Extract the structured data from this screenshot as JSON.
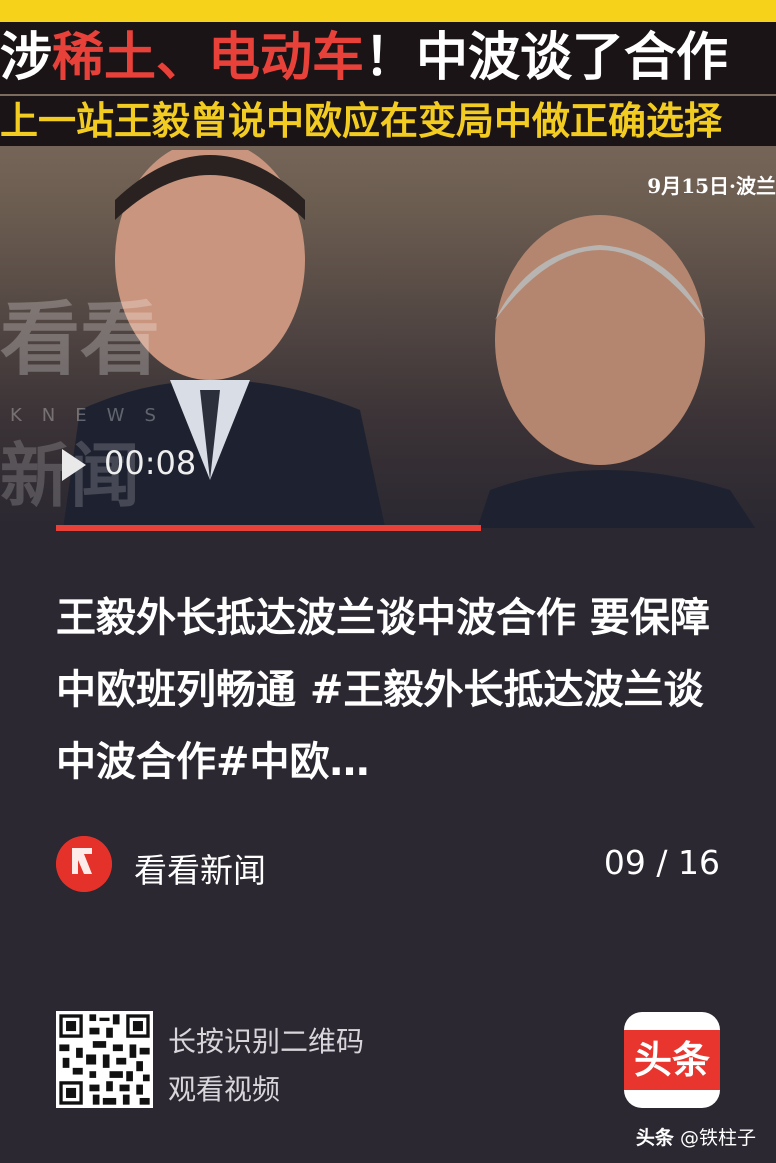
{
  "video": {
    "headline_part1": "涉",
    "headline_red1": "稀土、电动车",
    "headline_part2": "！中波谈了合作",
    "subline": "上一站王毅曾说中欧应在变局中做正确选择",
    "dateline": "9月15日·波兰",
    "watermark": "看看",
    "watermark_sub": "KNEWS",
    "watermark2": "新闻",
    "time": "00:08",
    "progress_percent": 64
  },
  "post": {
    "title": "王毅外长抵达波兰谈中波合作 要保障中欧班列畅通 #王毅外长抵达波兰谈中波合作#中欧…",
    "source_name": "看看新闻",
    "pager": "09 / 16"
  },
  "footer": {
    "qr_line1": "长按识别二维码",
    "qr_line2": "观看视频",
    "app_icon_text": "头条",
    "credit_brand": "头条",
    "credit_user": "@铁柱子"
  },
  "colors": {
    "accent": "#e8413a",
    "background": "#2b2831",
    "subtitle_yellow": "#f3cc22"
  }
}
